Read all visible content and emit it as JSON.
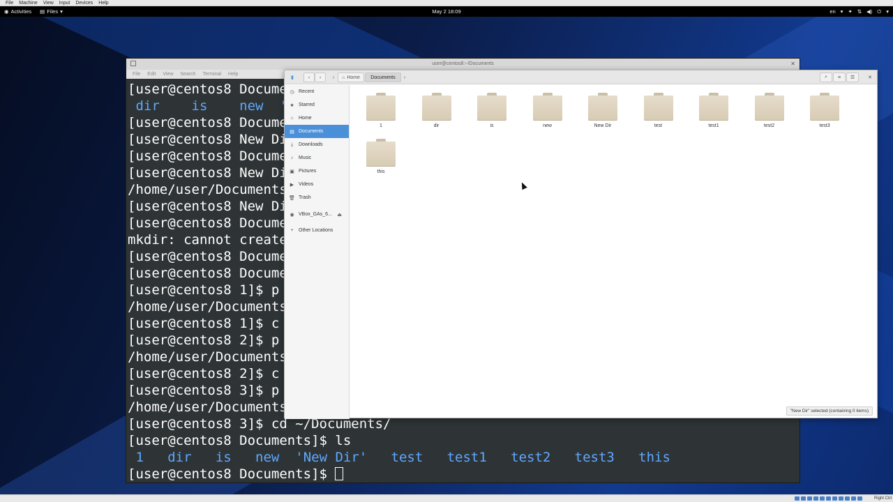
{
  "vbox_menu": [
    "File",
    "Machine",
    "View",
    "Input",
    "Devices",
    "Help"
  ],
  "topbar": {
    "activities": "Activities",
    "app_menu": "Files",
    "clock": "May 2  18:09",
    "lang": "en"
  },
  "terminal": {
    "title": "user@centos8:~/Documents",
    "menu": [
      "File",
      "Edit",
      "View",
      "Search",
      "Terminal",
      "Help"
    ],
    "lines": [
      "[user@centos8 Documents]$ ",
      " dir    is    new  'N",
      "[user@centos8 Documents]$ ",
      "[user@centos8 New Dir]$ ",
      "[user@centos8 Documents]$ ",
      "[user@centos8 New Dir]$ ",
      "/home/user/Documents",
      "[user@centos8 New Dir]$ ",
      "[user@centos8 Documents]$ ",
      "mkdir: cannot create",
      "[user@centos8 Documents]$ ",
      "[user@centos8 Documents]$ ",
      "[user@centos8 1]$ p",
      "/home/user/Documents",
      "[user@centos8 1]$ c",
      "[user@centos8 2]$ p",
      "/home/user/Documents",
      "[user@centos8 2]$ c",
      "[user@centos8 3]$ p",
      "/home/user/Documents",
      "[user@centos8 3]$ cd ~/Documents/",
      "[user@centos8 Documents]$ ls"
    ],
    "ls_output": [
      " 1",
      "   dir",
      "   is",
      "   new",
      "  'New Dir'",
      "   test",
      "   test1",
      "   test2",
      "   test3",
      "   this"
    ],
    "prompt": "[user@centos8 Documents]$ "
  },
  "files": {
    "breadcrumb": [
      "Home",
      "Documents"
    ],
    "sidebar": [
      {
        "label": "Recent",
        "icon": "clock-icon",
        "glyph": "◷"
      },
      {
        "label": "Starred",
        "icon": "star-icon",
        "glyph": "★"
      },
      {
        "label": "Home",
        "icon": "home-icon",
        "glyph": "⌂"
      },
      {
        "label": "Documents",
        "icon": "document-icon",
        "glyph": "▤",
        "active": true
      },
      {
        "label": "Downloads",
        "icon": "download-icon",
        "glyph": "⤓"
      },
      {
        "label": "Music",
        "icon": "music-icon",
        "glyph": "♪"
      },
      {
        "label": "Pictures",
        "icon": "picture-icon",
        "glyph": "▣"
      },
      {
        "label": "Videos",
        "icon": "video-icon",
        "glyph": "▶"
      },
      {
        "label": "Trash",
        "icon": "trash-icon",
        "glyph": "🗑"
      },
      {
        "label": "VBox_GAs_6...",
        "icon": "disc-icon",
        "glyph": "◉"
      },
      {
        "label": "Other Locations",
        "icon": "plus-icon",
        "glyph": "+"
      }
    ],
    "folders": [
      "1",
      "dir",
      "is",
      "new",
      "New Dir",
      "test",
      "test1",
      "test2",
      "test3",
      "this"
    ],
    "status": "\"New Dir\" selected  (containing 0 items)"
  },
  "vbox_status": {
    "host_key": "Right Ctrl"
  }
}
